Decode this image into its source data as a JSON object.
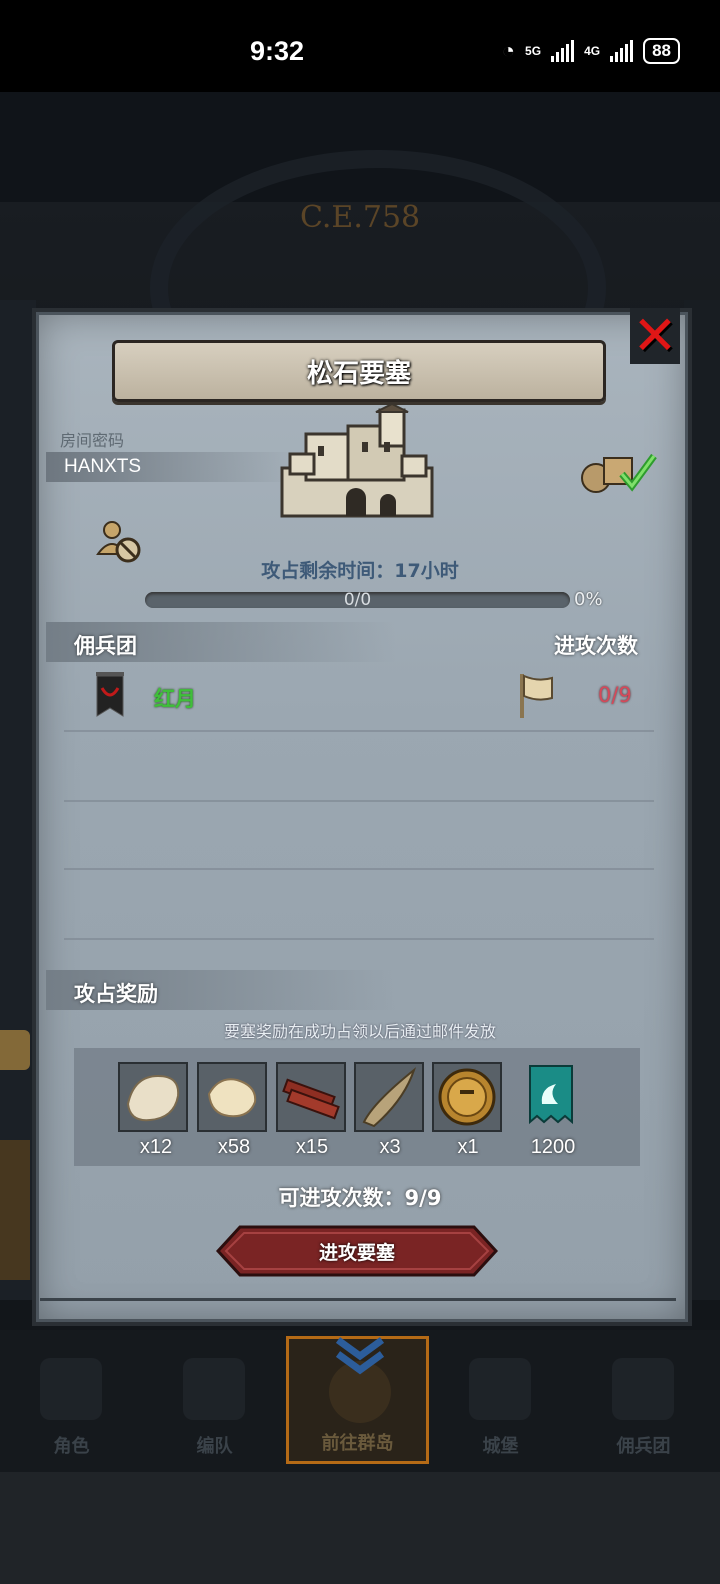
{
  "status_bar": {
    "time": "9:32",
    "network1": "5G",
    "network2": "4G",
    "battery": "88"
  },
  "background": {
    "era_label": "C.E.758"
  },
  "dialog": {
    "title": "松石要塞",
    "room_code_label": "房间密码",
    "room_code": "HANXTS",
    "time_remaining": "攻占剩余时间：17小时",
    "progress": {
      "text": "0/0",
      "percent_text": "0%",
      "value": 0
    },
    "mercenary_header": "佣兵团",
    "attack_count_header": "进攻次数",
    "mercenaries": [
      {
        "name": "红月",
        "attacks": "0/9"
      }
    ],
    "rewards_header": "攻占奖励",
    "rewards_note": "要塞奖励在成功占领以后通过邮件发放",
    "rewards": [
      {
        "icon": "fur-pelt-icon",
        "qty": "x12"
      },
      {
        "icon": "cloth-pelt-icon",
        "qty": "x58"
      },
      {
        "icon": "wood-planks-icon",
        "qty": "x15"
      },
      {
        "icon": "horn-icon",
        "qty": "x3"
      },
      {
        "icon": "knight-medal-icon",
        "qty": "x1"
      },
      {
        "icon": "guild-banner-icon",
        "qty": "1200"
      }
    ],
    "attempts": "可进攻次数：9/9",
    "attack_button": "进攻要塞"
  },
  "bottom_nav": [
    {
      "label": "角色",
      "active": false
    },
    {
      "label": "编队",
      "active": false
    },
    {
      "label": "前往群岛",
      "active": true
    },
    {
      "label": "城堡",
      "active": false
    },
    {
      "label": "佣兵团",
      "active": false
    }
  ],
  "colors": {
    "merc_name": "#3fbf3a",
    "attack_count": "#d5495a",
    "close_x": "#e01616",
    "button": "#7a2424"
  }
}
